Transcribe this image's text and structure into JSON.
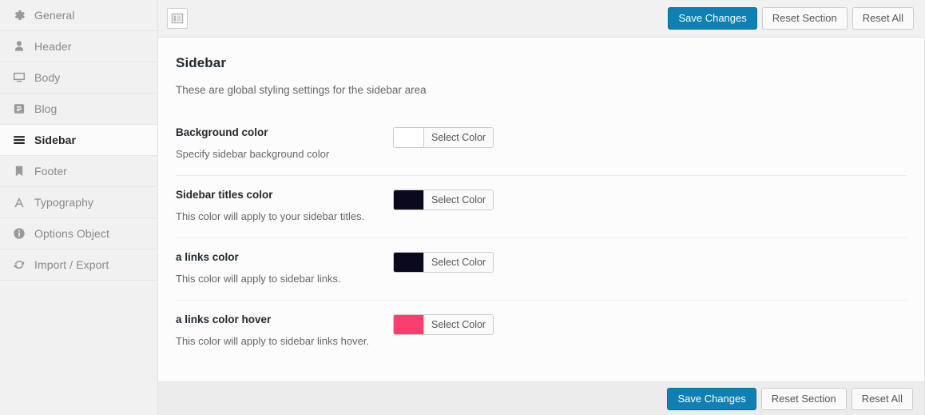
{
  "nav": {
    "items": [
      {
        "label": "General",
        "icon": "gear-icon",
        "active": false
      },
      {
        "label": "Header",
        "icon": "user-icon",
        "active": false
      },
      {
        "label": "Body",
        "icon": "monitor-icon",
        "active": false
      },
      {
        "label": "Blog",
        "icon": "blog-icon",
        "active": false
      },
      {
        "label": "Sidebar",
        "icon": "hamburger-icon",
        "active": true
      },
      {
        "label": "Footer",
        "icon": "bookmark-icon",
        "active": false
      },
      {
        "label": "Typography",
        "icon": "letter-a-icon",
        "active": false
      },
      {
        "label": "Options Object",
        "icon": "info-icon",
        "active": false
      },
      {
        "label": "Import / Export",
        "icon": "sync-arrows-icon",
        "active": false
      }
    ]
  },
  "toolbar": {
    "layout_toggle_icon": "layout-panel-icon",
    "save_label": "Save Changes",
    "reset_section_label": "Reset Section",
    "reset_all_label": "Reset All"
  },
  "panel": {
    "title": "Sidebar",
    "subtitle": "These are global styling settings for the sidebar area",
    "fields": [
      {
        "label": "Background color",
        "description": "Specify sidebar background color",
        "swatch": "#ffffff",
        "button_label": "Select Color"
      },
      {
        "label": "Sidebar titles color",
        "description": "This color will apply to your sidebar titles.",
        "swatch": "#0a0a1e",
        "button_label": "Select Color"
      },
      {
        "label": "a links color",
        "description": "This color will apply to sidebar links.",
        "swatch": "#0a0a1e",
        "button_label": "Select Color"
      },
      {
        "label": "a links color hover",
        "description": "This color will apply to sidebar links hover.",
        "swatch": "#fa3e6e",
        "button_label": "Select Color"
      }
    ]
  },
  "footer": {
    "save_label": "Save Changes",
    "reset_section_label": "Reset Section",
    "reset_all_label": "Reset All"
  },
  "colors": {
    "accent_blue": "#0e80b3",
    "nav_bg": "#f1f1f1",
    "panel_bg": "#fcfcfc"
  }
}
